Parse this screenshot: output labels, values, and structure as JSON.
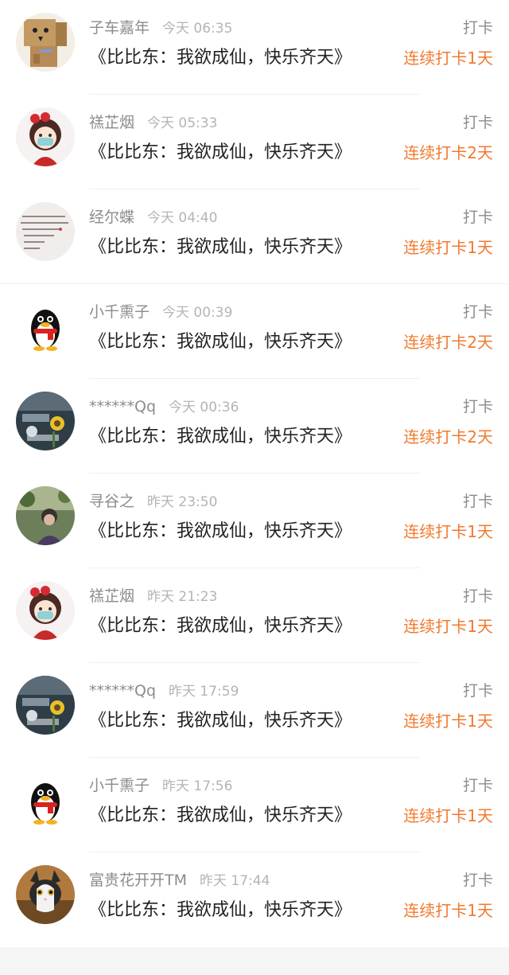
{
  "entries": [
    {
      "user": "子车嘉年",
      "time": "今天 06:35",
      "action": "打卡",
      "book": "《比比东：我欲成仙，快乐齐天》",
      "streak": "连续打卡1天",
      "avatar": "box-character-avatar"
    },
    {
      "user": "禚芷烟",
      "time": "今天 05:33",
      "action": "打卡",
      "book": "《比比东：我欲成仙，快乐齐天》",
      "streak": "连续打卡2天",
      "avatar": "cartoon-girl-avatar"
    },
    {
      "user": "经尔蝶",
      "time": "今天 04:40",
      "action": "打卡",
      "book": "《比比东：我欲成仙，快乐齐天》",
      "streak": "连续打卡1天",
      "avatar": "handwriting-avatar"
    },
    {
      "user": "小千熏子",
      "time": "今天 00:39",
      "action": "打卡",
      "book": "《比比东：我欲成仙，快乐齐天》",
      "streak": "连续打卡2天",
      "avatar": "qq-penguin-avatar"
    },
    {
      "user": "******Qq",
      "time": "今天 00:36",
      "action": "打卡",
      "book": "《比比东：我欲成仙，快乐齐天》",
      "streak": "连续打卡2天",
      "avatar": "photo-flowers-avatar"
    },
    {
      "user": "寻谷之",
      "time": "昨天 23:50",
      "action": "打卡",
      "book": "《比比东：我欲成仙，快乐齐天》",
      "streak": "连续打卡1天",
      "avatar": "photo-person-avatar"
    },
    {
      "user": "禚芷烟",
      "time": "昨天 21:23",
      "action": "打卡",
      "book": "《比比东：我欲成仙，快乐齐天》",
      "streak": "连续打卡1天",
      "avatar": "cartoon-girl-avatar"
    },
    {
      "user": "******Qq",
      "time": "昨天 17:59",
      "action": "打卡",
      "book": "《比比东：我欲成仙，快乐齐天》",
      "streak": "连续打卡1天",
      "avatar": "photo-flowers-avatar"
    },
    {
      "user": "小千熏子",
      "time": "昨天 17:56",
      "action": "打卡",
      "book": "《比比东：我欲成仙，快乐齐天》",
      "streak": "连续打卡1天",
      "avatar": "qq-penguin-avatar"
    },
    {
      "user": "富贵花开开TM",
      "time": "昨天 17:44",
      "action": "打卡",
      "book": "《比比东：我欲成仙，快乐齐天》",
      "streak": "连续打卡1天",
      "avatar": "cat-photo-avatar"
    }
  ],
  "colors": {
    "accent": "#f07a2e",
    "name_text": "#8c8c8c",
    "time_text": "#b4b4b4",
    "title_text": "#222222",
    "divider": "#f0f0f0"
  }
}
